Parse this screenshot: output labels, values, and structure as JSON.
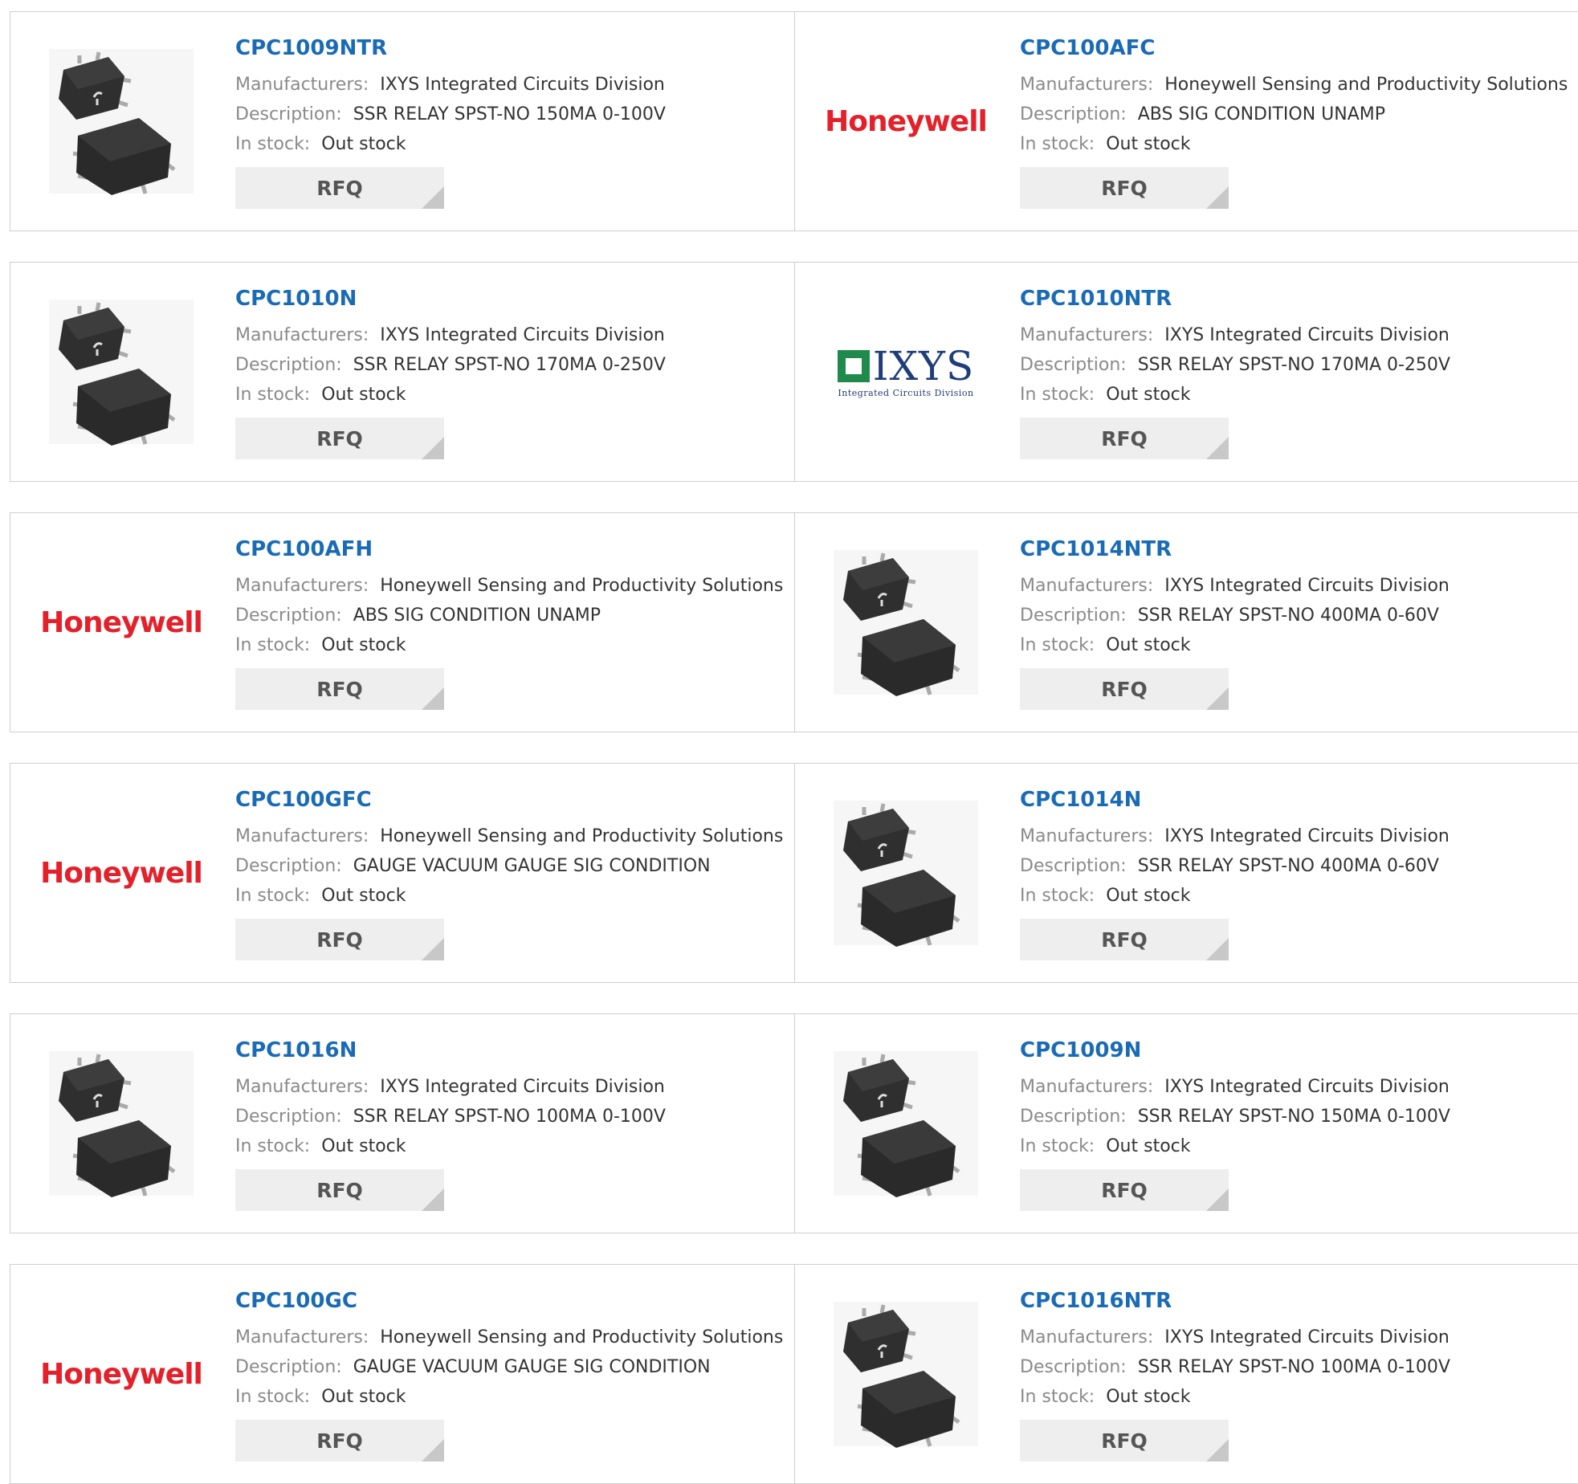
{
  "labels": {
    "manufacturers": "Manufacturers:",
    "description": "Description:",
    "in_stock": "In stock:",
    "rfq": "RFQ"
  },
  "logos": {
    "honeywell": "Honeywell",
    "ixys": "IXYS",
    "ixys_sub": "Integrated Circuits Division"
  },
  "colors": {
    "part_link": "#1a6bb5",
    "honeywell_red": "#e4212b",
    "rfq_bg": "#eeeeee"
  },
  "products": [
    {
      "part": "CPC1009NTR",
      "manufacturer": "IXYS Integrated Circuits Division",
      "description": "SSR RELAY SPST-NO 150MA 0-100V",
      "stock": "Out stock",
      "image": "relay-chip-image"
    },
    {
      "part": "CPC100AFC",
      "manufacturer": "Honeywell Sensing and Productivity Solutions",
      "description": "ABS SIG CONDITION UNAMP",
      "stock": "Out stock",
      "image": "honeywell-logo"
    },
    {
      "part": "CPC1010N",
      "manufacturer": "IXYS Integrated Circuits Division",
      "description": "SSR RELAY SPST-NO 170MA 0-250V",
      "stock": "Out stock",
      "image": "relay-chip-image"
    },
    {
      "part": "CPC1010NTR",
      "manufacturer": "IXYS Integrated Circuits Division",
      "description": "SSR RELAY SPST-NO 170MA 0-250V",
      "stock": "Out stock",
      "image": "ixys-logo"
    },
    {
      "part": "CPC100AFH",
      "manufacturer": "Honeywell Sensing and Productivity Solutions",
      "description": "ABS SIG CONDITION UNAMP",
      "stock": "Out stock",
      "image": "honeywell-logo"
    },
    {
      "part": "CPC1014NTR",
      "manufacturer": "IXYS Integrated Circuits Division",
      "description": "SSR RELAY SPST-NO 400MA 0-60V",
      "stock": "Out stock",
      "image": "relay-chip-image"
    },
    {
      "part": "CPC100GFC",
      "manufacturer": "Honeywell Sensing and Productivity Solutions",
      "description": "GAUGE VACUUM GAUGE SIG CONDITION",
      "stock": "Out stock",
      "image": "honeywell-logo"
    },
    {
      "part": "CPC1014N",
      "manufacturer": "IXYS Integrated Circuits Division",
      "description": "SSR RELAY SPST-NO 400MA 0-60V",
      "stock": "Out stock",
      "image": "relay-chip-image"
    },
    {
      "part": "CPC1016N",
      "manufacturer": "IXYS Integrated Circuits Division",
      "description": "SSR RELAY SPST-NO 100MA 0-100V",
      "stock": "Out stock",
      "image": "relay-chip-image"
    },
    {
      "part": "CPC1009N",
      "manufacturer": "IXYS Integrated Circuits Division",
      "description": "SSR RELAY SPST-NO 150MA 0-100V",
      "stock": "Out stock",
      "image": "relay-chip-image"
    },
    {
      "part": "CPC100GC",
      "manufacturer": "Honeywell Sensing and Productivity Solutions",
      "description": "GAUGE VACUUM GAUGE SIG CONDITION",
      "stock": "Out stock",
      "image": "honeywell-logo"
    },
    {
      "part": "CPC1016NTR",
      "manufacturer": "IXYS Integrated Circuits Division",
      "description": "SSR RELAY SPST-NO 100MA 0-100V",
      "stock": "Out stock",
      "image": "relay-chip-image"
    }
  ]
}
